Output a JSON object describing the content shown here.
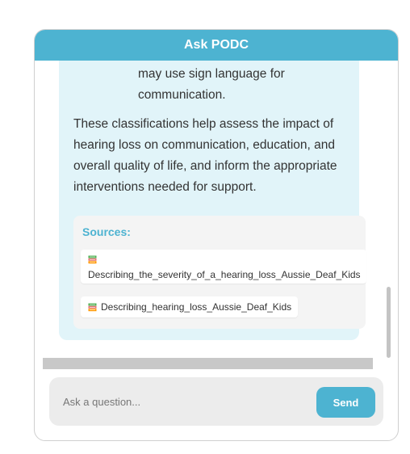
{
  "header": {
    "title": "Ask PODC"
  },
  "message": {
    "list_text": "may use sign language for communication.",
    "paragraph": "These classifications help assess the impact of hearing loss on communication, education, and overall quality of life, and inform the appropriate interventions needed for support.",
    "sources": {
      "title": "Sources:",
      "items": [
        {
          "icon": "books-icon",
          "label": "Describing_the_severity_of_a_hearing_loss_Aussie_Deaf_Kids"
        },
        {
          "icon": "books-icon",
          "label": "Describing_hearing_loss_Aussie_Deaf_Kids"
        }
      ]
    }
  },
  "input": {
    "placeholder": "Ask a question...",
    "value": ""
  },
  "send_button": {
    "label": "Send"
  },
  "colors": {
    "accent": "#4db3d1",
    "message_bg": "#e1f4f9",
    "sources_bg": "#f4f4f4",
    "input_bg": "#ececec"
  }
}
